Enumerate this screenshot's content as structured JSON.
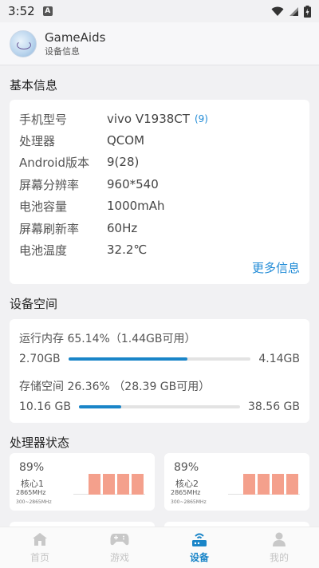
{
  "status_bar": {
    "time": "3:52",
    "notif_letter": "A"
  },
  "header": {
    "title": "GameAids",
    "subtitle": "设备信息"
  },
  "basic_info": {
    "title": "基本信息",
    "rows": [
      {
        "label": "手机型号",
        "value": "vivo V1938CT",
        "badge": "(9)"
      },
      {
        "label": "处理器",
        "value": "QCOM"
      },
      {
        "label": "Android版本",
        "value": "9(28)"
      },
      {
        "label": "屏幕分辨率",
        "value": "960*540"
      },
      {
        "label": "电池容量",
        "value": "1000mAh"
      },
      {
        "label": "屏幕刷新率",
        "value": "60Hz"
      },
      {
        "label": "电池温度",
        "value": "32.2℃"
      }
    ],
    "more_label": "更多信息"
  },
  "storage": {
    "title": "设备空间",
    "ram": {
      "label": "运行内存 65.14%（1.44GB可用）",
      "used": "2.70GB",
      "total": "4.14GB",
      "fraction": 0.6514
    },
    "rom": {
      "label": "存储空间 26.36% （28.39 GB可用）",
      "used": "10.16 GB",
      "total": "38.56 GB",
      "fraction": 0.2636
    }
  },
  "cpu": {
    "title": "处理器状态",
    "cores": [
      {
        "percent": "89%",
        "name": "核心1",
        "freq": "2865MHz",
        "range": "300~2865MHz"
      },
      {
        "percent": "89%",
        "name": "核心2",
        "freq": "2865MHz",
        "range": "300~2865MHz"
      }
    ]
  },
  "nav": {
    "items": [
      {
        "label": "首页",
        "icon": "home-icon"
      },
      {
        "label": "游戏",
        "icon": "gamepad-icon"
      },
      {
        "label": "设备",
        "icon": "device-icon",
        "active": true
      },
      {
        "label": "我的",
        "icon": "user-icon"
      }
    ]
  },
  "colors": {
    "accent": "#1a85c8",
    "cpu_bar": "#f4a08c"
  }
}
